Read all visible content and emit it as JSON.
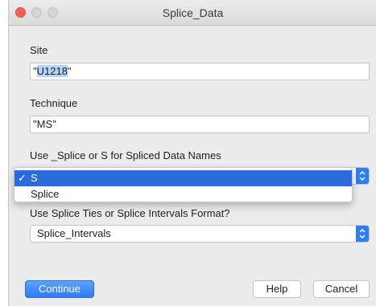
{
  "window": {
    "title": "Splice_Data"
  },
  "site": {
    "label": "Site",
    "value_prefix": "\"",
    "value_selected": "U1218",
    "value_suffix": "\""
  },
  "technique": {
    "label": "Technique",
    "value": "\"MS\""
  },
  "splice_names": {
    "label": "Use _Splice or S for Spliced Data Names",
    "checkmark": "✓",
    "options": [
      {
        "label": "S",
        "selected": true
      },
      {
        "label": "Splice",
        "selected": false
      }
    ]
  },
  "tie_format": {
    "label": "Use Splice Ties or Splice Intervals Format?",
    "value": "Splice_Intervals"
  },
  "buttons": {
    "continue": "Continue",
    "help": "Help",
    "cancel": "Cancel"
  },
  "colors": {
    "accent": "#2f7df6",
    "close": "#fc605b",
    "selection": "#b4d5fe"
  },
  "icons": {
    "stepper": "up-down-chevron-icon"
  }
}
